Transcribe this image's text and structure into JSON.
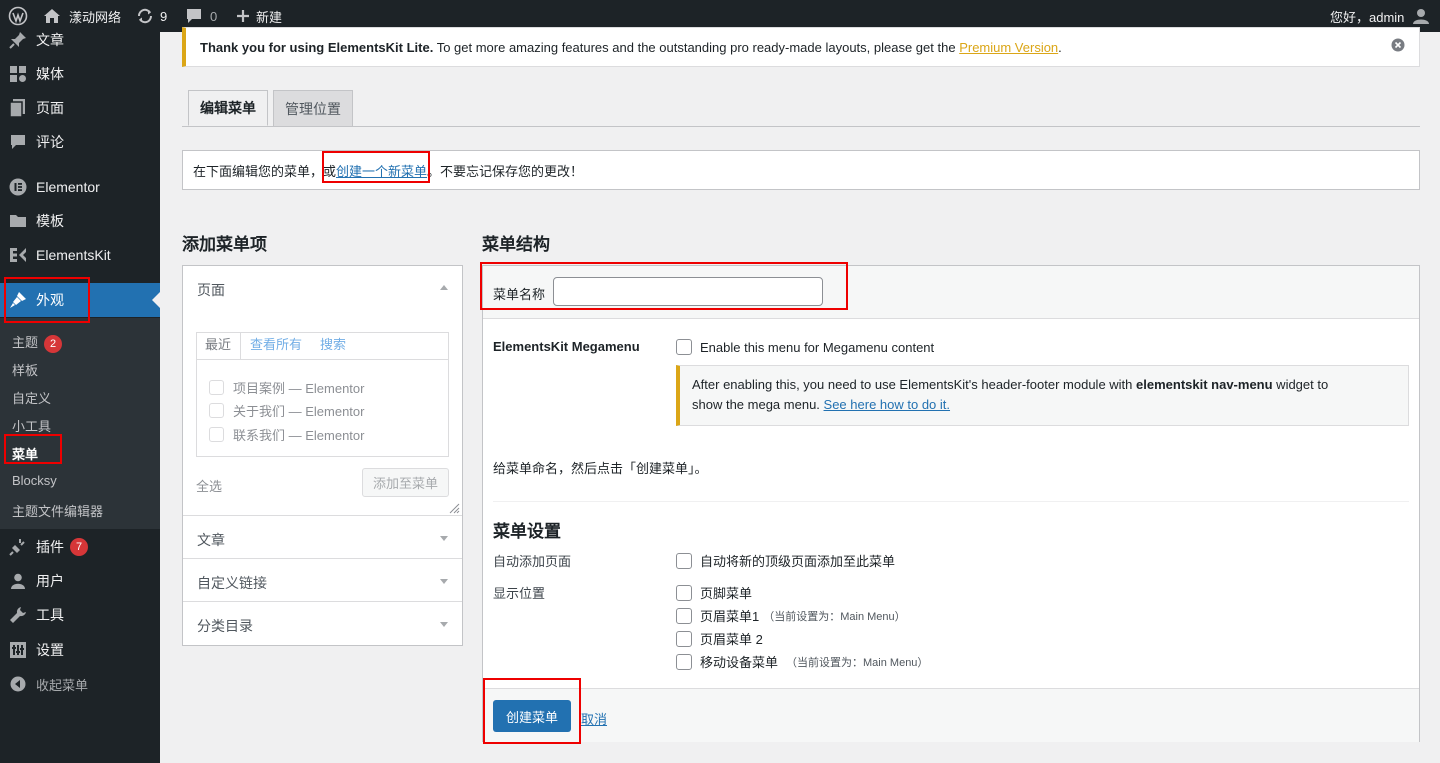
{
  "adminbar": {
    "site_name": "漾动网络",
    "updates_count": "9",
    "comments_count": "0",
    "new_label": "新建",
    "greeting": "您好，admin"
  },
  "sidebar": {
    "items": [
      {
        "label": "文章",
        "icon": "pushpin-icon"
      },
      {
        "label": "媒体",
        "icon": "media-icon"
      },
      {
        "label": "页面",
        "icon": "page-icon"
      },
      {
        "label": "评论",
        "icon": "comment-icon"
      },
      {
        "label": "Elementor",
        "icon": "elementor-icon"
      },
      {
        "label": "模板",
        "icon": "folder-icon"
      },
      {
        "label": "ElementsKit",
        "icon": "elementskit-icon"
      },
      {
        "label": "外观",
        "icon": "brush-icon"
      },
      {
        "label": "插件",
        "icon": "plugin-icon"
      },
      {
        "label": "用户",
        "icon": "user-icon"
      },
      {
        "label": "工具",
        "icon": "wrench-icon"
      },
      {
        "label": "设置",
        "icon": "settings-icon"
      },
      {
        "label": "收起菜单",
        "icon": "collapse-icon"
      }
    ],
    "sub_items": [
      "主题",
      "样板",
      "自定义",
      "小工具",
      "菜单",
      "Blocksy",
      "主题文件编辑器"
    ],
    "theme_badge": "2",
    "plugins_badge": "7"
  },
  "notice": {
    "bold": "Thank you for using ElementsKit Lite.",
    "text": " To get more amazing features and the outstanding pro ready-made layouts, please get the ",
    "link": "Premium Version",
    "end": "."
  },
  "tabs": {
    "edit": "编辑菜单",
    "manage": "管理位置"
  },
  "infobar": {
    "text1": "在下面编辑您的菜单，",
    "link_prefix": "或",
    "link": "创建一个新菜单",
    "text2": "。不要忘记保存您的更改！"
  },
  "left": {
    "heading": "添加菜单项",
    "pages_title": "页面",
    "subtabs": [
      "最近",
      "查看所有",
      "搜索"
    ],
    "recent_pages": [
      "项目案例 — Elementor",
      "关于我们 — Elementor",
      "联系我们 — Elementor"
    ],
    "select_all": "全选",
    "add_button": "添加至菜单",
    "sections": [
      "文章",
      "自定义链接",
      "分类目录"
    ]
  },
  "right": {
    "heading": "菜单结构",
    "menu_name_label": "菜单名称",
    "menu_name_value": "",
    "megamenu_label": "ElementsKit Megamenu",
    "megamenu_checkbox": "Enable this menu for Megamenu content",
    "mm_note_1": "After enabling this, you need to use ElementsKit's header-footer module with ",
    "mm_note_bold": "elementskit nav-menu",
    "mm_note_2": " widget to",
    "mm_note_3": "show the mega menu. ",
    "mm_note_link": "See here how to do it.",
    "instruction": "给菜单命名，然后点击「创建菜单」。",
    "settings_heading": "菜单设置",
    "auto_add_label": "自动添加页面",
    "auto_add_option": "自动将新的顶级页面添加至此菜单",
    "display_label": "显示位置",
    "locations": [
      {
        "name": "页脚菜单",
        "note": ""
      },
      {
        "name": "页眉菜单1",
        "note": "（当前设置为：Main Menu）"
      },
      {
        "name": "页眉菜单 2",
        "note": ""
      },
      {
        "name": "移动设备菜单",
        "note": "（当前设置为：Main Menu）"
      }
    ],
    "create_button": "创建菜单",
    "cancel_link": "取消"
  }
}
